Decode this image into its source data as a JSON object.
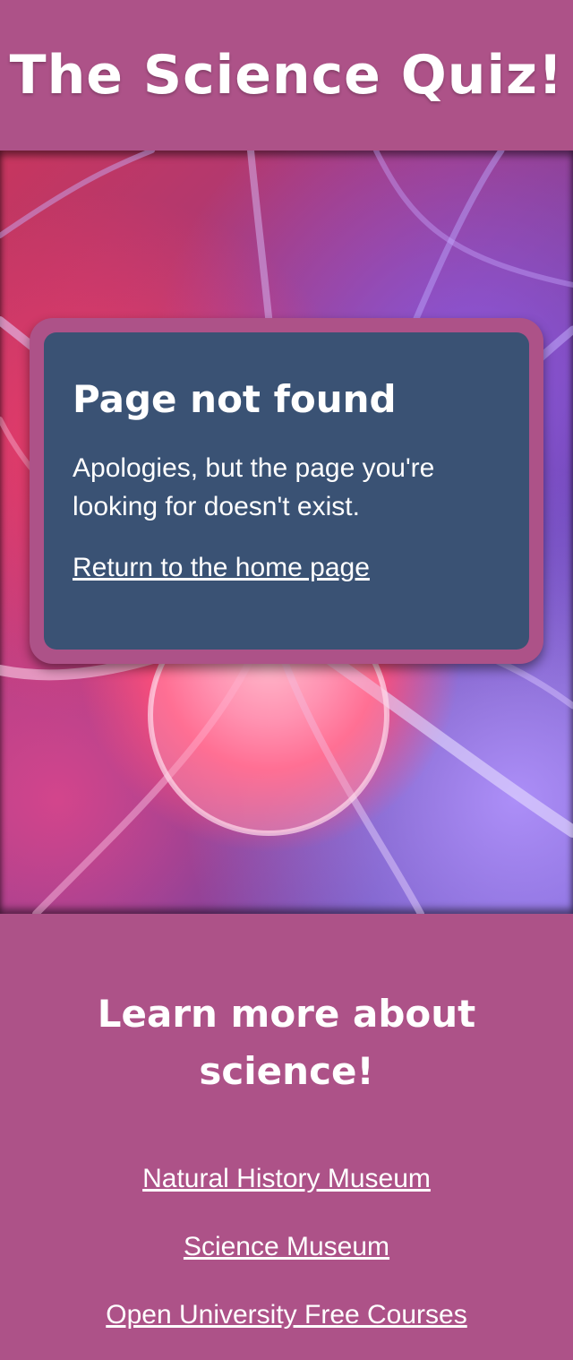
{
  "header": {
    "title": "The Science Quiz!"
  },
  "error_card": {
    "title": "Page not found",
    "message": "Apologies, but the page you're looking for doesn't exist.",
    "home_link": "Return to the home page"
  },
  "footer": {
    "heading": "Learn more about science!",
    "links": [
      {
        "label": "Natural History Museum"
      },
      {
        "label": "Science Museum"
      },
      {
        "label": "Open University Free Courses"
      }
    ]
  },
  "colors": {
    "brand": "#ad5288",
    "card": "#3a5274",
    "text": "#ffffff"
  }
}
